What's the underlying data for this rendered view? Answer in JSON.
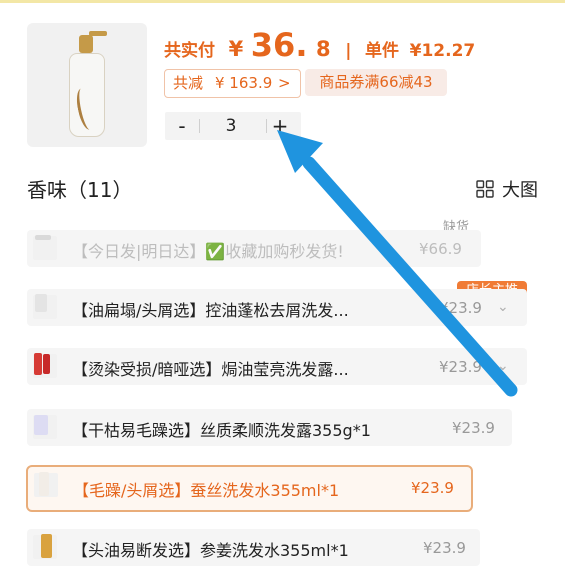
{
  "colors": {
    "accent": "#e5661d",
    "badge_background": "#f07b35",
    "selected_border": "#e9ad7a",
    "arrow_blue": "#1f94df",
    "top_bar": "#f3e7a6"
  },
  "product": {
    "thumbnail_icon": "shampoo-bottle",
    "price_label": "共实付",
    "currency": "¥",
    "price_main": "36.",
    "price_fraction": "8",
    "separator": "|",
    "unit_label": "单件",
    "unit_price": "¥12.27",
    "discount_label": "共减",
    "discount_value": "¥ 163.9",
    "discount_chevron": ">",
    "coupon": "商品券满66减43"
  },
  "quantity": {
    "minus": "-",
    "value": "3",
    "plus": "+"
  },
  "section": {
    "title": "香味（11）",
    "view_icon": "grid-icon",
    "view_label": "大图"
  },
  "badges": {
    "out_of_stock": "缺货",
    "shop_pick": "店长主推"
  },
  "variants": [
    {
      "label": "【今日发|明日达】✅收藏加购秒发货!",
      "price": "¥66.9",
      "state": "out-of-stock"
    },
    {
      "label": "【油扁塌/头屑选】控油蓬松去屑洗发...",
      "price": "¥23.9",
      "state": "recommended"
    },
    {
      "label": "【烫染受损/暗哑选】焗油莹亮洗发露...",
      "price": "¥23.9",
      "state": "normal"
    },
    {
      "label": "【干枯易毛躁选】丝质柔顺洗发露355g*1",
      "price": "¥23.9",
      "state": "normal"
    },
    {
      "label": "【毛躁/头屑选】蚕丝洗发水355ml*1",
      "price": "¥23.9",
      "state": "selected"
    },
    {
      "label": "【头油易断发选】参姜洗发水355ml*1",
      "price": "¥23.9",
      "state": "normal"
    }
  ]
}
